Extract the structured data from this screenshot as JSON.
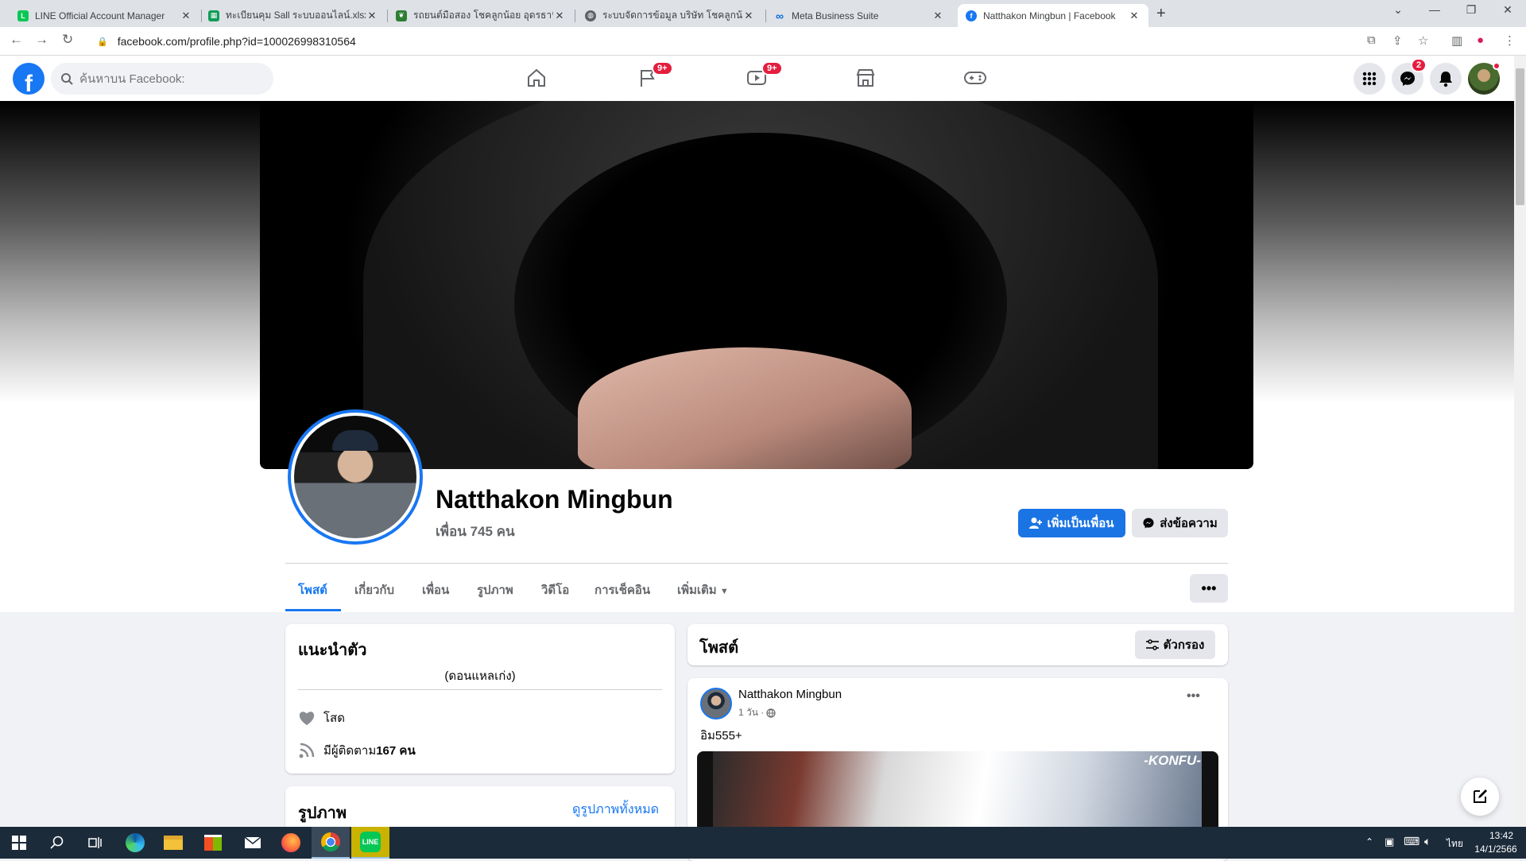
{
  "browser": {
    "tabs": [
      {
        "title": "LINE Official Account Manager",
        "icon": "line-icon",
        "color": "#06c755"
      },
      {
        "title": "ทะเบียนคุม Sall ระบบออนไลน์.xlsx - G",
        "icon": "sheets-icon",
        "color": "#0f9d58"
      },
      {
        "title": "รถยนต์มือสอง โชคลูกน้อย อุดรธานี",
        "icon": "leaf-icon",
        "color": "#2e7d32"
      },
      {
        "title": "ระบบจัดการข้อมูล บริษัท โชคลูกน้อย ร",
        "icon": "globe-icon",
        "color": "#5f6368"
      },
      {
        "title": "Meta Business Suite",
        "icon": "meta-icon",
        "color": "#0668e1"
      },
      {
        "title": "Natthakon Mingbun | Facebook",
        "icon": "facebook-icon",
        "color": "#1877f2"
      }
    ],
    "url": "facebook.com/profile.php?id=100026998310564"
  },
  "fb": {
    "search_placeholder": "ค้นหาบน Facebook:",
    "watch_badge": "9+",
    "pages_badge": "9+",
    "messenger_badge": "2"
  },
  "profile": {
    "name": "Natthakon Mingbun",
    "friends": "เพื่อน 745 คน",
    "add_friend": "เพิ่มเป็นเพื่อน",
    "message": "ส่งข้อความ",
    "tabs": [
      "โพสต์",
      "เกี่ยวกับ",
      "เพื่อน",
      "รูปภาพ",
      "วิดีโอ",
      "การเช็คอิน",
      "เพิ่มเติม"
    ]
  },
  "intro": {
    "title": "แนะนำตัว",
    "bio": "(ดอนแหลเก่ง)",
    "relationship": "โสด",
    "followers_prefix": "มีผู้ติดตาม ",
    "followers_count": "167 คน"
  },
  "photos": {
    "title": "รูปภาพ",
    "see_all": "ดูรูปภาพทั้งหมด"
  },
  "posts": {
    "title": "โพสต์",
    "filter": "ตัวกรอง",
    "post": {
      "author": "Natthakon Mingbun",
      "time": "1 วัน ·",
      "text": "อิม555+",
      "image_caption": "-KONFU-"
    }
  },
  "taskbar": {
    "time": "13:42",
    "date": "14/1/2566",
    "lang": "ไทย"
  }
}
